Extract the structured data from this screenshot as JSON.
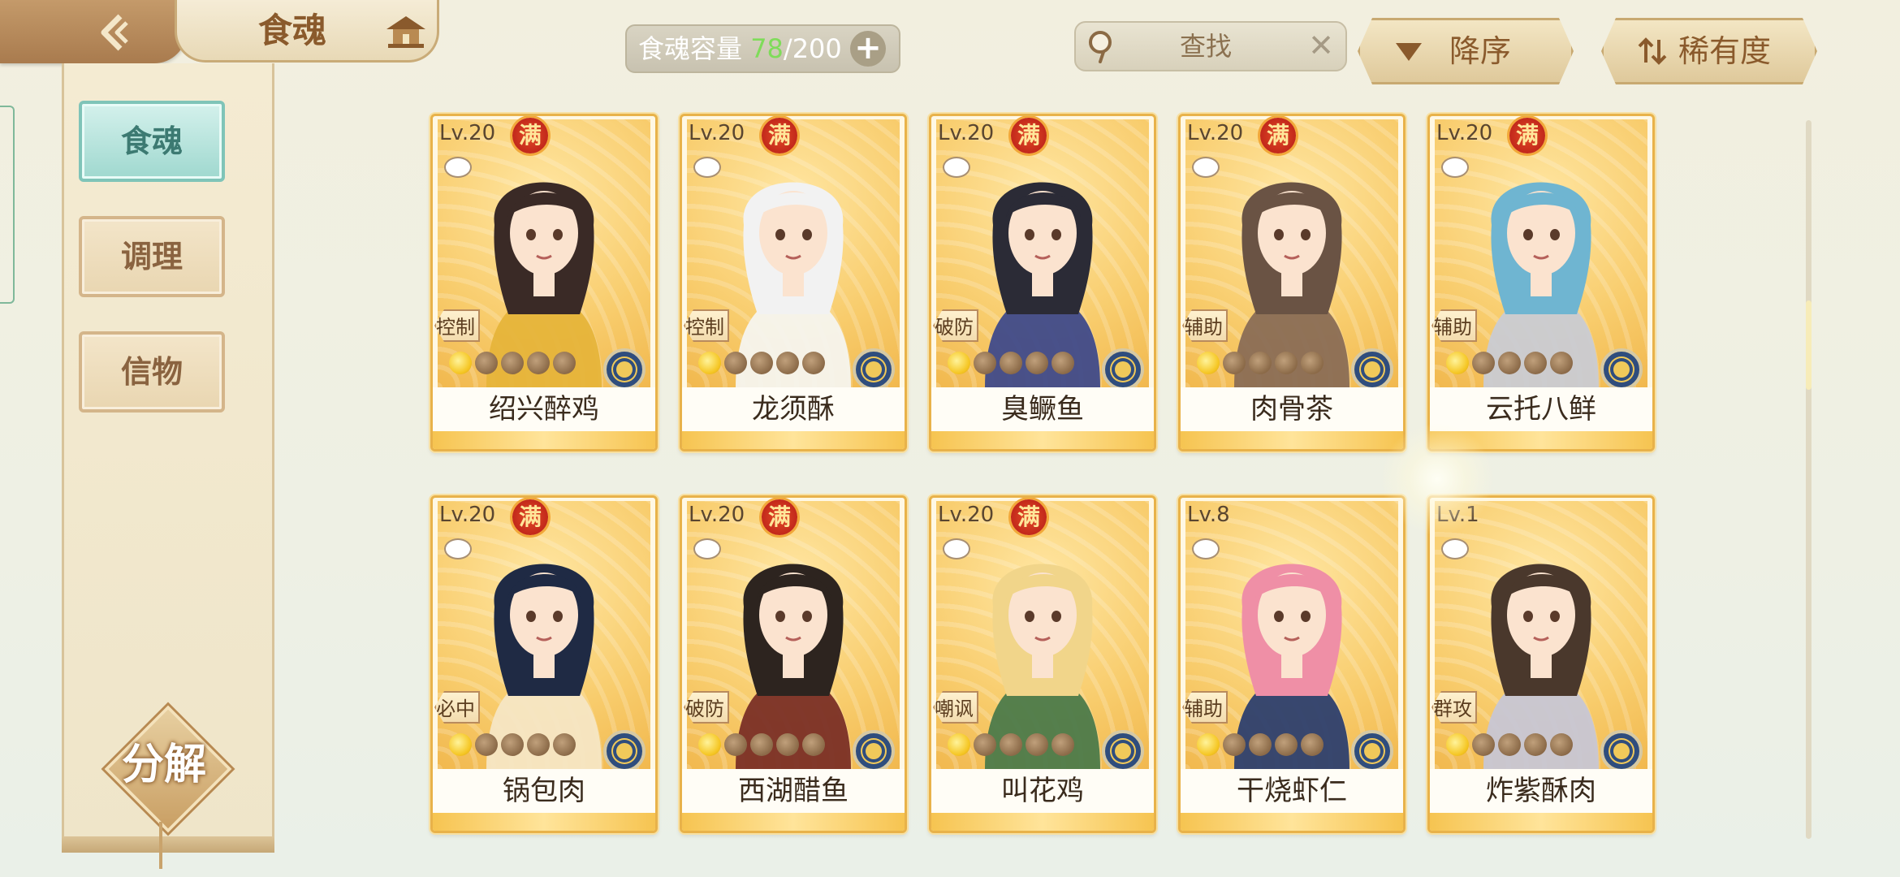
{
  "header": {
    "title": "食魂",
    "capacity": {
      "label": "食魂容量",
      "used": "78",
      "separator": "/",
      "total": "200",
      "add_symbol": "+"
    },
    "search": {
      "placeholder": "查找",
      "clear_symbol": "✕"
    },
    "sort_order_label": "降序",
    "sort_by_label": "稀有度"
  },
  "sidebar": {
    "items": [
      {
        "label": "食魂",
        "active": true
      },
      {
        "label": "调理",
        "active": false
      },
      {
        "label": "信物",
        "active": false
      }
    ],
    "decompose_label": "分解"
  },
  "colors": {
    "accent": "#e8b24a",
    "active_tab": "#9fd8cf",
    "capacity_used": "#7fdc5a",
    "full_badge": "#c2281b"
  },
  "cards": [
    {
      "level": "Lv.20",
      "full": "满",
      "role": "控制",
      "name": "绍兴醉鸡",
      "stars": 1,
      "hair": "#3a2a26",
      "robe": "#e6b43a"
    },
    {
      "level": "Lv.20",
      "full": "满",
      "role": "控制",
      "name": "龙须酥",
      "stars": 1,
      "hair": "#f2f2f2",
      "robe": "#f6f4ee"
    },
    {
      "level": "Lv.20",
      "full": "满",
      "role": "破防",
      "name": "臭鳜鱼",
      "stars": 1,
      "hair": "#2b2b36",
      "robe": "#3f4a8a"
    },
    {
      "level": "Lv.20",
      "full": "满",
      "role": "辅助",
      "name": "肉骨茶",
      "stars": 1,
      "hair": "#6a5344",
      "robe": "#8a6d55"
    },
    {
      "level": "Lv.20",
      "full": "满",
      "role": "辅助",
      "name": "云托八鲜",
      "stars": 1,
      "hair": "#6fb5d1",
      "robe": "#c9cbd3"
    },
    {
      "level": "Lv.20",
      "full": "满",
      "role": "必中",
      "name": "锅包肉",
      "stars": 1,
      "hair": "#1f2a44",
      "robe": "#f5e6c4"
    },
    {
      "level": "Lv.20",
      "full": "满",
      "role": "破防",
      "name": "西湖醋鱼",
      "stars": 1,
      "hair": "#2d241f",
      "robe": "#7a2f26"
    },
    {
      "level": "Lv.20",
      "full": "满",
      "role": "嘲讽",
      "name": "叫花鸡",
      "stars": 1,
      "hair": "#f1d58a",
      "robe": "#4c7a4a"
    },
    {
      "level": "Lv.8",
      "full": "",
      "role": "辅助",
      "name": "干烧虾仁",
      "stars": 1,
      "hair": "#ef8fa6",
      "robe": "#2d3f6e"
    },
    {
      "level": "Lv.1",
      "full": "",
      "role": "群攻",
      "name": "炸紫酥肉",
      "stars": 1,
      "hair": "#4a382c",
      "robe": "#c7c6d4"
    }
  ]
}
